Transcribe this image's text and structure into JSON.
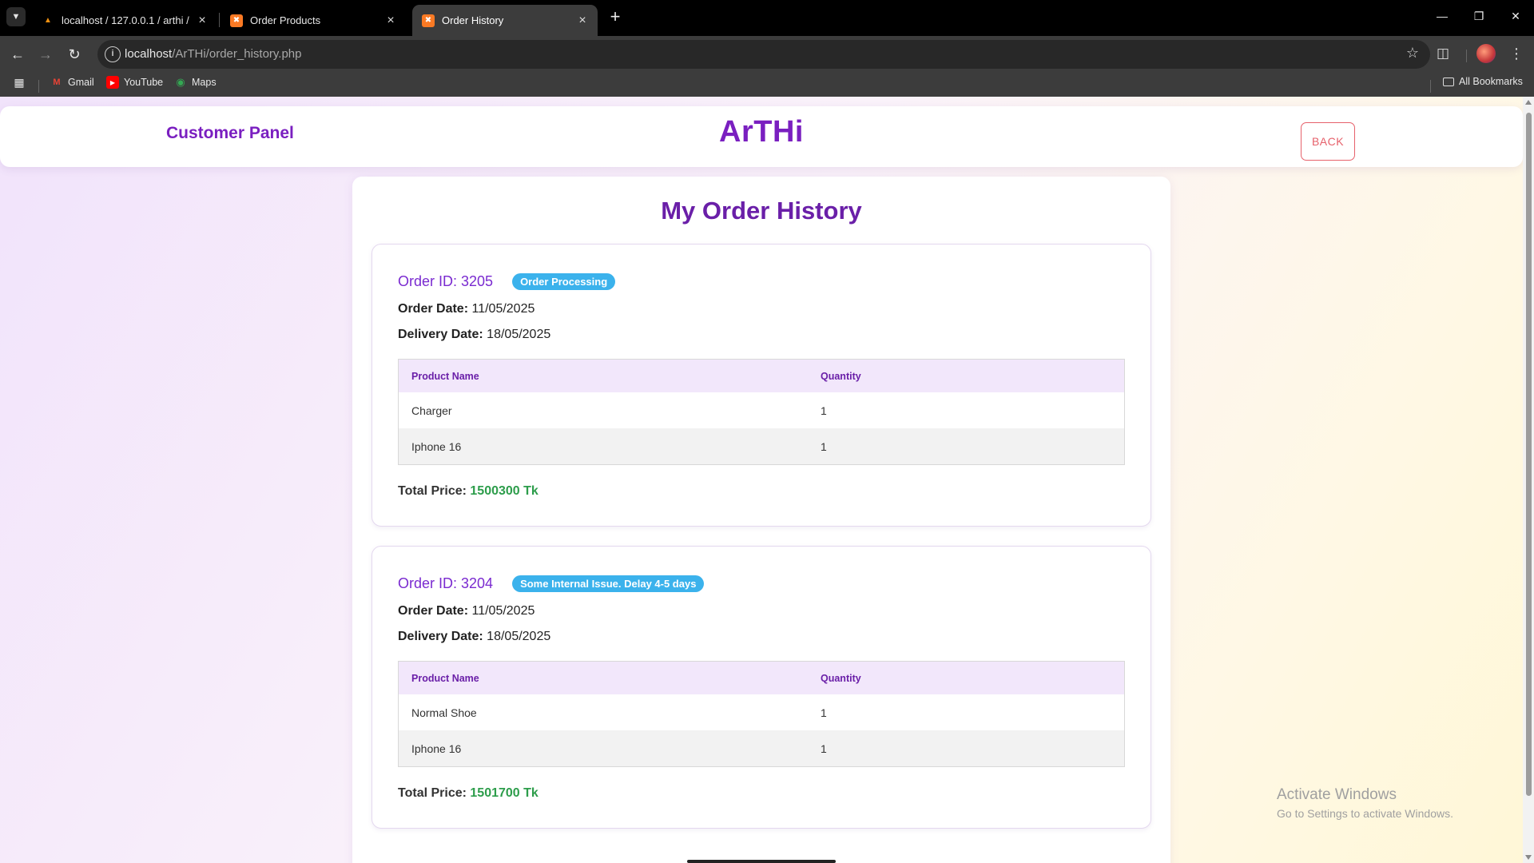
{
  "browser": {
    "tabs": [
      {
        "title": "localhost / 127.0.0.1 / arthi / cu",
        "favicon": "phpmyadmin-icon",
        "active": false
      },
      {
        "title": "Order Products",
        "favicon": "xampp-icon",
        "active": false
      },
      {
        "title": "Order History",
        "favicon": "xampp-icon",
        "active": true
      }
    ],
    "url_host": "localhost",
    "url_path": "/ArTHi/order_history.php",
    "bookmarks": [
      {
        "label": "Gmail",
        "icon": "gmail-icon"
      },
      {
        "label": "YouTube",
        "icon": "youtube-icon"
      },
      {
        "label": "Maps",
        "icon": "maps-icon"
      }
    ],
    "all_bookmarks": "All Bookmarks"
  },
  "header": {
    "panel_title": "Customer Panel",
    "brand": "ArTHi",
    "back_label": "BACK"
  },
  "page": {
    "title": "My Order History"
  },
  "orders": [
    {
      "id_label": "Order ID: 3205",
      "status": "Order Processing",
      "order_date_label": "Order Date:",
      "order_date": "11/05/2025",
      "delivery_date_label": "Delivery Date:",
      "delivery_date": "18/05/2025",
      "columns": [
        "Product Name",
        "Quantity"
      ],
      "items": [
        {
          "product": "Charger",
          "quantity": "1"
        },
        {
          "product": "Iphone 16",
          "quantity": "1"
        }
      ],
      "total_label": "Total Price:",
      "total": "1500300 Tk"
    },
    {
      "id_label": "Order ID: 3204",
      "status": "Some Internal Issue. Delay 4-5 days",
      "order_date_label": "Order Date:",
      "order_date": "11/05/2025",
      "delivery_date_label": "Delivery Date:",
      "delivery_date": "18/05/2025",
      "columns": [
        "Product Name",
        "Quantity"
      ],
      "items": [
        {
          "product": "Normal Shoe",
          "quantity": "1"
        },
        {
          "product": "Iphone 16",
          "quantity": "1"
        }
      ],
      "total_label": "Total Price:",
      "total": "1501700 Tk"
    }
  ],
  "watermark": {
    "line1": "Activate Windows",
    "line2": "Go to Settings to activate Windows."
  },
  "colors": {
    "brand_purple": "#7a1fc0",
    "status_badge": "#3bb2ec",
    "price_green": "#2d9d4b",
    "back_red": "#e6616b"
  }
}
